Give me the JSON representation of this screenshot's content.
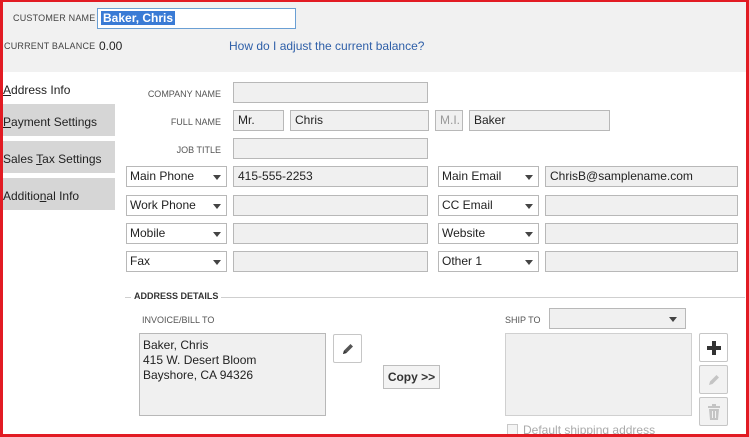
{
  "header": {
    "customer_name_label": "CUSTOMER NAME",
    "customer_name_value": "Baker, Chris",
    "current_balance_label": "CURRENT BALANCE",
    "current_balance_value": "0.00",
    "adjust_link": "How do I adjust the current balance?"
  },
  "tabs": [
    {
      "pre": "",
      "u": "A",
      "post": "ddress Info",
      "active": true
    },
    {
      "pre": "",
      "u": "P",
      "post": "ayment Settings",
      "active": false
    },
    {
      "pre": "Sales ",
      "u": "T",
      "post": "ax Settings",
      "active": false
    },
    {
      "pre": "Additio",
      "u": "n",
      "post": "al Info",
      "active": false
    }
  ],
  "form": {
    "company_name_label": "COMPANY NAME",
    "company_name_value": "",
    "full_name_label": "FULL NAME",
    "salutation": "Mr.",
    "first_name": "Chris",
    "mi_placeholder": "M.I.",
    "last_name": "Baker",
    "job_title_label": "JOB TITLE",
    "job_title_value": "",
    "contacts_left": [
      {
        "type": "Main Phone",
        "value": "415-555-2253"
      },
      {
        "type": "Work Phone",
        "value": ""
      },
      {
        "type": "Mobile",
        "value": ""
      },
      {
        "type": "Fax",
        "value": ""
      }
    ],
    "contacts_right": [
      {
        "type": "Main Email",
        "value": "ChrisB@samplename.com"
      },
      {
        "type": "CC Email",
        "value": ""
      },
      {
        "type": "Website",
        "value": ""
      },
      {
        "type": "Other 1",
        "value": ""
      }
    ]
  },
  "address": {
    "section_title": "ADDRESS DETAILS",
    "bill_to_label": "INVOICE/BILL TO",
    "bill_to_lines": [
      "Baker, Chris",
      "415 W. Desert Bloom",
      "Bayshore, CA 94326"
    ],
    "copy_button": "Copy >>",
    "ship_to_label": "SHIP TO",
    "ship_to_selected": "",
    "default_shipping_label": "Default shipping address"
  },
  "icons": [
    "pencil-icon",
    "plus-icon",
    "pencil-icon",
    "trash-icon",
    "chevron-down-icon"
  ]
}
